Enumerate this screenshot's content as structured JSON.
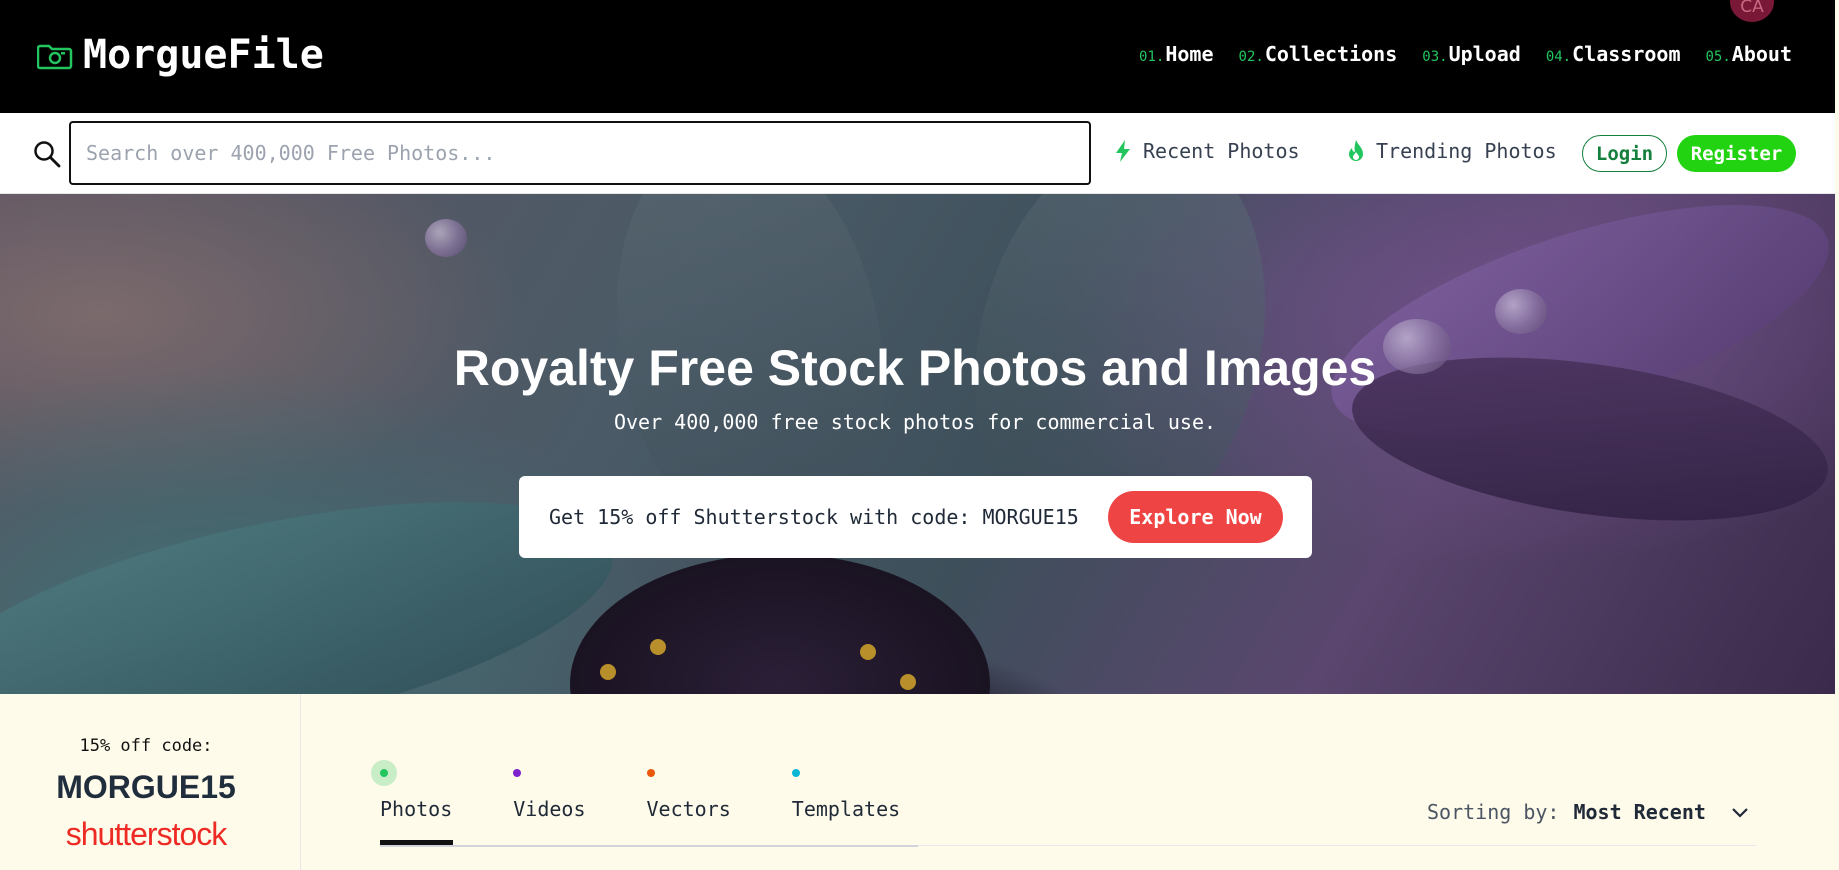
{
  "header": {
    "logo_text": "MorgueFile",
    "avatar_initials": "CA",
    "nav": [
      {
        "num": "01.",
        "label": "Home"
      },
      {
        "num": "02.",
        "label": "Collections"
      },
      {
        "num": "03.",
        "label": "Upload"
      },
      {
        "num": "04.",
        "label": "Classroom"
      },
      {
        "num": "05.",
        "label": "About"
      }
    ]
  },
  "search": {
    "placeholder": "Search over 400,000 Free Photos...",
    "value": "",
    "recent_label": "Recent Photos",
    "trending_label": "Trending Photos",
    "login_label": "Login",
    "register_label": "Register"
  },
  "hero": {
    "title": "Royalty Free Stock Photos and Images",
    "subtitle": "Over 400,000 free stock photos for commercial use.",
    "promo_text": "Get 15% off Shutterstock with code: MORGUE15",
    "promo_button": "Explore Now"
  },
  "sidebar": {
    "label": "15% off code:",
    "code": "MORGUE15",
    "brand": "shutterstock"
  },
  "tabs": [
    {
      "label": "Photos",
      "color": "#22c55e",
      "active": true
    },
    {
      "label": "Videos",
      "color": "#7e22ce",
      "active": false
    },
    {
      "label": "Vectors",
      "color": "#ea580c",
      "active": false
    },
    {
      "label": "Templates",
      "color": "#06b6d4",
      "active": false
    }
  ],
  "sorting": {
    "label": "Sorting by:",
    "value": "Most Recent"
  },
  "colors": {
    "accent_green": "#22c55e",
    "register_green": "#22d311",
    "explore_red": "#ef4444",
    "brand_red": "#ee2a24"
  }
}
